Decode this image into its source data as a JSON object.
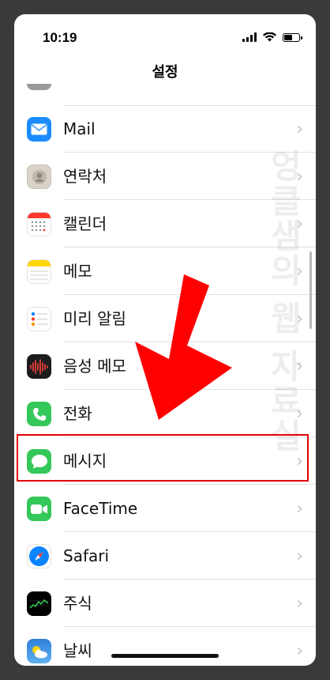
{
  "status": {
    "time": "10:19"
  },
  "nav": {
    "title": "설정"
  },
  "rows": [
    {
      "label": "Mail",
      "icon": "mail-icon",
      "color": "#1a8cff"
    },
    {
      "label": "연락처",
      "icon": "contacts-icon",
      "color": "#d9d3c7"
    },
    {
      "label": "캘린더",
      "icon": "calendar-icon",
      "color": "#ffffff"
    },
    {
      "label": "메모",
      "icon": "notes-icon",
      "color": "#ffffff"
    },
    {
      "label": "미리 알림",
      "icon": "reminders-icon",
      "color": "#ffffff"
    },
    {
      "label": "음성 메모",
      "icon": "voice-memos-icon",
      "color": "#1c1c1e"
    },
    {
      "label": "전화",
      "icon": "phone-icon",
      "color": "#34c759"
    },
    {
      "label": "메시지",
      "icon": "messages-icon",
      "color": "#34c759"
    },
    {
      "label": "FaceTime",
      "icon": "facetime-icon",
      "color": "#34c759"
    },
    {
      "label": "Safari",
      "icon": "safari-icon",
      "color": "#0a84ff"
    },
    {
      "label": "주식",
      "icon": "stocks-icon",
      "color": "#000000"
    },
    {
      "label": "날씨",
      "icon": "weather-icon",
      "color": "#3a8dde"
    }
  ],
  "chevron": "›",
  "watermark": "엉클샘의 웹 자료실",
  "annotation": {
    "highlight_color": "#e30000",
    "arrow_color": "#ff0000"
  }
}
